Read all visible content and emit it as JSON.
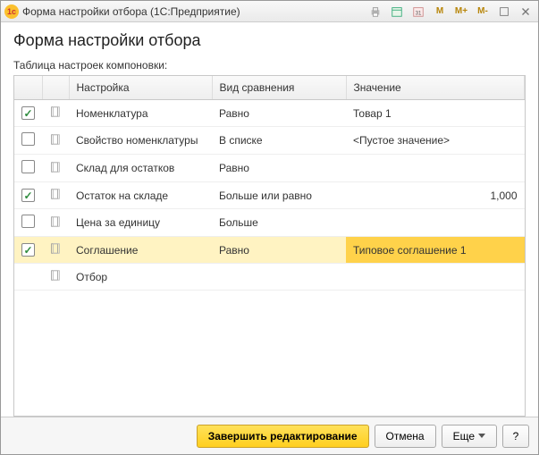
{
  "titlebar": {
    "title": "Форма настройки отбора  (1С:Предприятие)",
    "mem_buttons": [
      "M",
      "M+",
      "M-"
    ]
  },
  "page": {
    "title": "Форма настройки отбора",
    "subtitle": "Таблица настроек компоновки:"
  },
  "columns": {
    "setting": "Настройка",
    "compare": "Вид сравнения",
    "value": "Значение"
  },
  "rows": [
    {
      "checked": true,
      "label": "Номенклатура",
      "compare": "Равно",
      "value": "Товар 1",
      "numeric": false,
      "active": false,
      "has_check": true
    },
    {
      "checked": false,
      "label": "Свойство номенклатуры",
      "compare": "В списке",
      "value": "<Пустое значение>",
      "numeric": false,
      "active": false,
      "has_check": true
    },
    {
      "checked": false,
      "label": "Склад для остатков",
      "compare": "Равно",
      "value": "",
      "numeric": false,
      "active": false,
      "has_check": true
    },
    {
      "checked": true,
      "label": "Остаток на складе",
      "compare": "Больше или равно",
      "value": "1,000",
      "numeric": true,
      "active": false,
      "has_check": true
    },
    {
      "checked": false,
      "label": "Цена за единицу",
      "compare": "Больше",
      "value": "",
      "numeric": false,
      "active": false,
      "has_check": true
    },
    {
      "checked": true,
      "label": "Соглашение",
      "compare": "Равно",
      "value": "Типовое соглашение 1",
      "numeric": false,
      "active": true,
      "has_check": true
    },
    {
      "checked": false,
      "label": "Отбор",
      "compare": "",
      "value": "",
      "numeric": false,
      "active": false,
      "has_check": false
    }
  ],
  "footer": {
    "finish": "Завершить редактирование",
    "cancel": "Отмена",
    "more": "Еще",
    "help": "?"
  }
}
